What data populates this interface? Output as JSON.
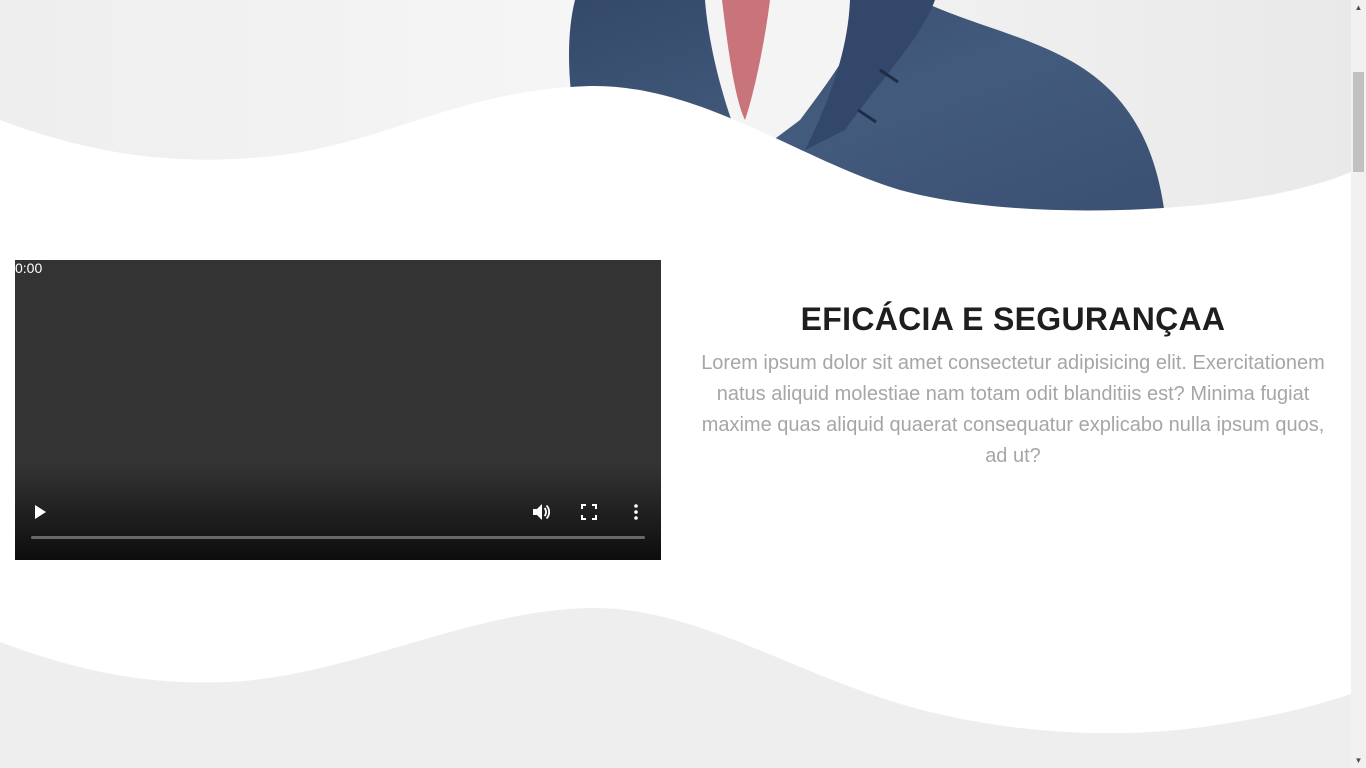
{
  "section": {
    "title": "EFICÁCIA E SEGURANÇAA",
    "body": "Lorem ipsum dolor sit amet consectetur adipisicing elit. Exercitationem natus aliquid molestiae nam totam odit blanditiis est? Minima fugiat maxime quas aliquid quaerat consequatur explicabo nulla ipsum quos, ad ut?"
  },
  "video": {
    "current_time": "0:00",
    "progress": 0,
    "icons": {
      "play": "play-icon",
      "volume": "volume-icon",
      "fullscreen": "fullscreen-icon",
      "more": "more-vertical-icon"
    }
  },
  "hero": {
    "image": "man-in-suit-photo"
  },
  "scrollbar": {
    "up": "▲",
    "down": "▼"
  },
  "colors": {
    "title": "#1e1e1e",
    "body_text": "#a6a6a6",
    "video_bg": "#333333",
    "wave_gray": "#eeeeee",
    "suit": "#3f5676"
  }
}
